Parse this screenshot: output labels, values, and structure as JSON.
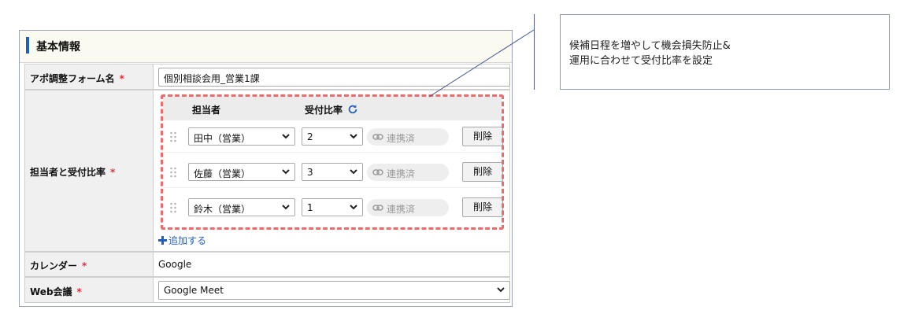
{
  "section": {
    "title": "基本情報"
  },
  "form_name": {
    "label": "アポ調整フォーム名",
    "required_mark": "*",
    "value": "個別相談会用_営業1課"
  },
  "members": {
    "label": "担当者と受付比率",
    "required_mark": "*",
    "col_person": "担当者",
    "col_ratio": "受付比率",
    "rows": [
      {
        "person": "田中（営業）",
        "ratio": "2",
        "status": "連携済",
        "delete_label": "削除"
      },
      {
        "person": "佐藤（営業）",
        "ratio": "3",
        "status": "連携済",
        "delete_label": "削除"
      },
      {
        "person": "鈴木（営業）",
        "ratio": "1",
        "status": "連携済",
        "delete_label": "削除"
      }
    ],
    "add_label": "追加する"
  },
  "calendar": {
    "label": "カレンダー",
    "required_mark": "*",
    "value": "Google"
  },
  "web_meeting": {
    "label": "Web会議",
    "required_mark": "*",
    "value": "Google Meet"
  },
  "callout": {
    "line1": "候補日程を増やして機会損失防止&",
    "line2": "運用に合わせて受付比率を設定"
  },
  "colors": {
    "accent": "#1f5fbf",
    "required": "#e0303a",
    "highlight_dash": "#ef6b6b"
  },
  "icons": [
    "refresh-icon",
    "drag-handle-icon",
    "chevron-down-icon",
    "link-icon",
    "plus-icon"
  ]
}
